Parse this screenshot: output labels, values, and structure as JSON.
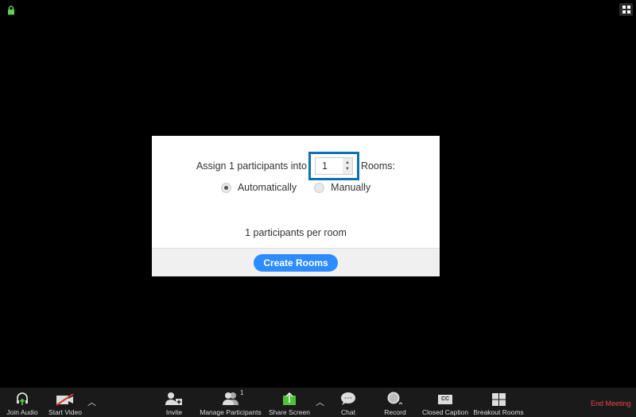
{
  "dialog": {
    "assign_prefix": "Assign 1 participants into",
    "rooms_count": "1",
    "rooms_suffix": "Rooms:",
    "option_auto": "Automatically",
    "option_manual": "Manually",
    "selected_option": "Automatically",
    "per_room_text": "1 participants per room",
    "create_label": "Create Rooms"
  },
  "toolbar": {
    "join_audio": "Join Audio",
    "start_video": "Start Video",
    "invite": "Invite",
    "manage_participants": "Manage Participants",
    "participant_count": "1",
    "share_screen": "Share Screen",
    "chat": "Chat",
    "record": "Record",
    "closed_caption": "Closed Caption",
    "cc_glyph": "CC",
    "breakout_rooms": "Breakout Rooms",
    "end_meeting": "End Meeting"
  },
  "colors": {
    "accent": "#2d8cff",
    "focus": "#0e71b5",
    "end": "#e8483f",
    "green": "#4fc23a"
  }
}
